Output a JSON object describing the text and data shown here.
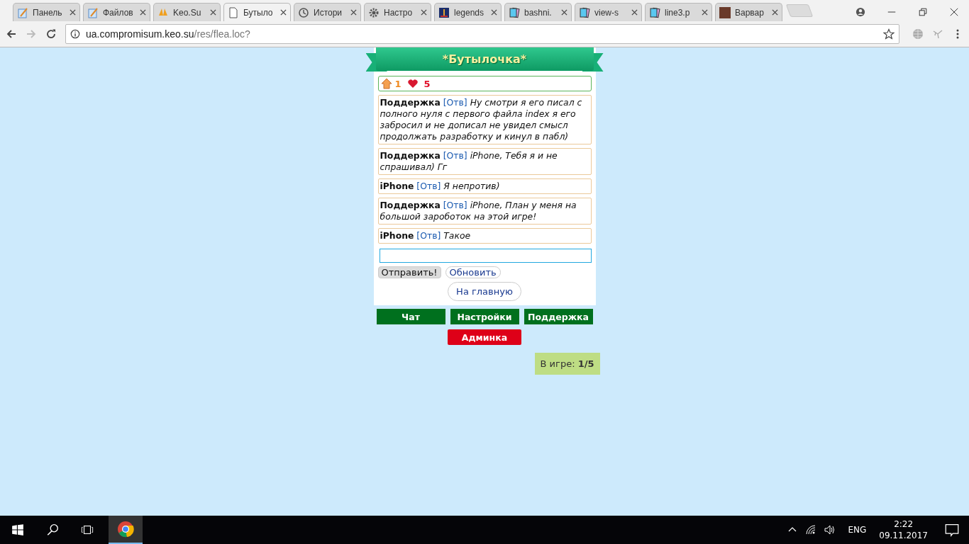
{
  "browser": {
    "tabs": [
      {
        "label": "Панель",
        "selected": false,
        "kind": "notepad"
      },
      {
        "label": "Файлов",
        "selected": false,
        "kind": "notepad"
      },
      {
        "label": "Keo.Su",
        "selected": false,
        "kind": "sail"
      },
      {
        "label": "Бутыло",
        "selected": true,
        "kind": "page"
      },
      {
        "label": "Истори",
        "selected": false,
        "kind": "history"
      },
      {
        "label": "Настро",
        "selected": false,
        "kind": "settings"
      },
      {
        "label": "legends",
        "selected": false,
        "kind": "tower"
      },
      {
        "label": "bashni.",
        "selected": false,
        "kind": "cards"
      },
      {
        "label": "view-s",
        "selected": false,
        "kind": "cards"
      },
      {
        "label": "line3.p",
        "selected": false,
        "kind": "cards"
      },
      {
        "label": "Варвар",
        "selected": false,
        "kind": "photo"
      }
    ],
    "address": {
      "host": "ua.compromisum.keo.su",
      "path": "/res/flea.loc?"
    }
  },
  "page": {
    "title": "*Бутылочка*",
    "stats": {
      "level": "1",
      "hearts": "5"
    },
    "messages": [
      {
        "author": "Поддержка",
        "reply": "[Отв]",
        "text": "Ну смотри я его писал с полного нуля с первого файла index я его забросил и не дописал не увидел смысл продолжать разработку и кинул в пабл)"
      },
      {
        "author": "Поддержка",
        "reply": "[Отв]",
        "text": "iPhone, Тебя я и не спрашивал) Гг"
      },
      {
        "author": "iPhone",
        "reply": "[Отв]",
        "text": "Я непротив)"
      },
      {
        "author": "Поддержка",
        "reply": "[Отв]",
        "text": "iPhone, План у меня на большой зароботок на этой игре!"
      },
      {
        "author": "iPhone",
        "reply": "[Отв]",
        "text": "Такое"
      }
    ],
    "send_button": "Отправить!",
    "refresh_button": "Обновить",
    "home_button": "На главную",
    "nav": [
      {
        "label": "Чат",
        "kind": "green"
      },
      {
        "label": "Настройки",
        "kind": "green"
      },
      {
        "label": "Поддержка",
        "kind": "green"
      },
      {
        "label": "Админка",
        "kind": "red"
      }
    ],
    "online": {
      "label": "В игре:",
      "value": "1/5"
    }
  },
  "taskbar": {
    "language": "ENG",
    "time": "2:22",
    "date": "09.11.2017"
  }
}
